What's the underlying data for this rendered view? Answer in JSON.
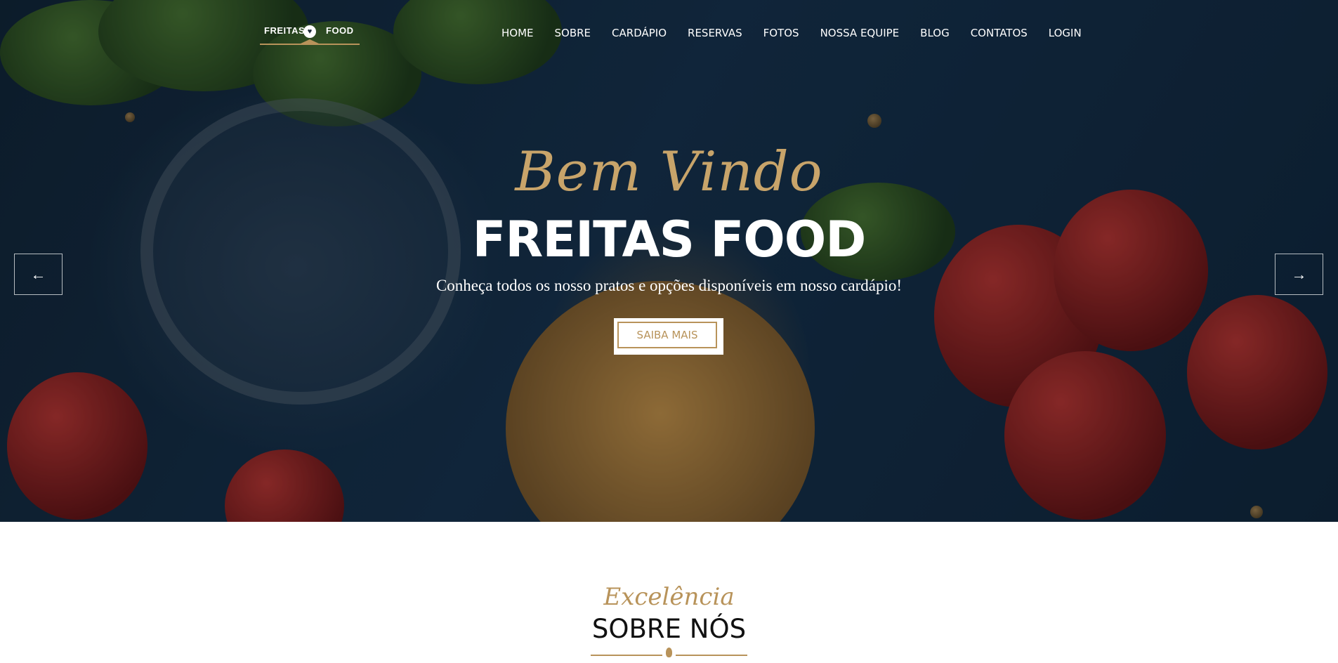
{
  "brand": {
    "logo_left": "FREITAS",
    "logo_right": "FOOD"
  },
  "nav": {
    "items": [
      "HOME",
      "SOBRE",
      "CARDÁPIO",
      "RESERVAS",
      "FOTOS",
      "NOSSA EQUIPE",
      "BLOG",
      "CONTATOS",
      "LOGIN"
    ]
  },
  "hero": {
    "welcome": "Bem Vindo",
    "title": "FREITAS FOOD",
    "tagline": "Conheça todos os nosso pratos e opções disponíveis em nosso cardápio!",
    "cta_label": "SAIBA MAIS",
    "prev_arrow": "←",
    "next_arrow": "→"
  },
  "about": {
    "subtitle": "Excelência",
    "title": "SOBRE NÓS"
  },
  "colors": {
    "accent": "#b8935a",
    "hero_bg": "#14304a"
  }
}
